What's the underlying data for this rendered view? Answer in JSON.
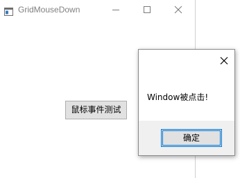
{
  "window": {
    "title": "GridMouseDown",
    "icon": "app-window-icon",
    "controls": [
      "minimize-icon",
      "maximize-icon",
      "close-icon"
    ]
  },
  "main": {
    "test_button_label": "鼠标事件测试"
  },
  "dialog": {
    "message": "Window被点击!",
    "ok_label": "确定",
    "close_icon": "close-icon",
    "accent_color": "#0078d7"
  }
}
